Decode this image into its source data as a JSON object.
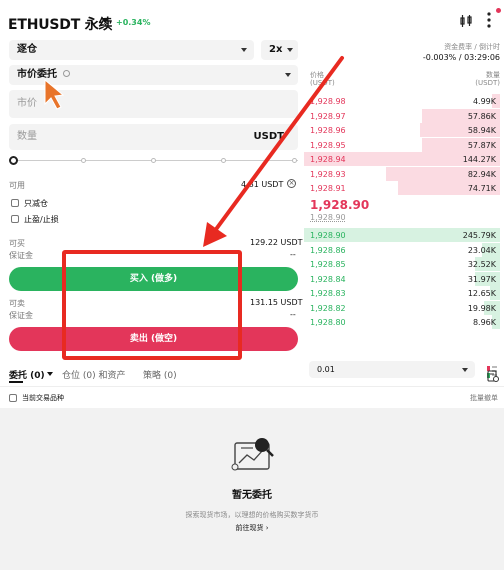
{
  "header": {
    "pair": "ETHUSDT 永续",
    "change": "+0.34%"
  },
  "form": {
    "margin_mode": "逐仓",
    "leverage": "2x",
    "order_type": "市价委托",
    "price_placeholder": "市价",
    "amount_placeholder": "数量",
    "amount_unit": "USDT",
    "available_label": "可用",
    "available_value": "4.81 USDT",
    "reduce_only_label": "只减仓",
    "tpsl_label": "止盈/止损",
    "buy_can_label": "可买",
    "buy_can_value": "129.22 USDT",
    "buy_margin_label": "保证金",
    "buy_margin_value": "--",
    "buy_button": "买入 (做多)",
    "sell_can_label": "可卖",
    "sell_can_value": "131.15 USDT",
    "sell_margin_label": "保证金",
    "sell_margin_value": "--",
    "sell_button": "卖出 (做空)"
  },
  "orderbook": {
    "funding_label": "资金费率 / 倒计时",
    "funding_value": "-0.003% / 03:29:06",
    "price_header": "价格",
    "price_unit": "(USDT)",
    "qty_header": "数量",
    "qty_unit": "(USDT)",
    "asks": [
      {
        "price": "1,928.98",
        "qty": "4.99K",
        "depth": 0.04
      },
      {
        "price": "1,928.97",
        "qty": "57.86K",
        "depth": 0.4
      },
      {
        "price": "1,928.96",
        "qty": "58.94K",
        "depth": 0.41
      },
      {
        "price": "1,928.95",
        "qty": "57.87K",
        "depth": 0.4
      },
      {
        "price": "1,928.94",
        "qty": "144.27K",
        "depth": 1.0
      },
      {
        "price": "1,928.93",
        "qty": "82.94K",
        "depth": 0.58
      },
      {
        "price": "1,928.91",
        "qty": "74.71K",
        "depth": 0.52
      }
    ],
    "last_price": "1,928.90",
    "mark_price": "1,928.90",
    "bids": [
      {
        "price": "1,928.90",
        "qty": "245.79K",
        "depth": 1.0
      },
      {
        "price": "1,928.86",
        "qty": "23.04K",
        "depth": 0.09
      },
      {
        "price": "1,928.85",
        "qty": "32.52K",
        "depth": 0.13
      },
      {
        "price": "1,928.84",
        "qty": "31.97K",
        "depth": 0.13
      },
      {
        "price": "1,928.83",
        "qty": "12.65K",
        "depth": 0.05
      },
      {
        "price": "1,928.82",
        "qty": "19.98K",
        "depth": 0.08
      },
      {
        "price": "1,928.80",
        "qty": "8.96K",
        "depth": 0.04
      }
    ],
    "precision": "0.01"
  },
  "tabs": {
    "orders": "委托 (0)",
    "positions": "仓位 (0) 和资产",
    "strategy": "策略 (0)"
  },
  "filter": {
    "current_symbol": "当前交易品种",
    "batch_cancel": "批量撤单"
  },
  "empty": {
    "title": "暂无委托",
    "desc": "探索现货市场，以理想的价格购买数字货币",
    "link": "前往现货 ›"
  },
  "colors": {
    "buy": "#2ab35f",
    "sell": "#e3365a",
    "annotation": "#e82a21"
  }
}
